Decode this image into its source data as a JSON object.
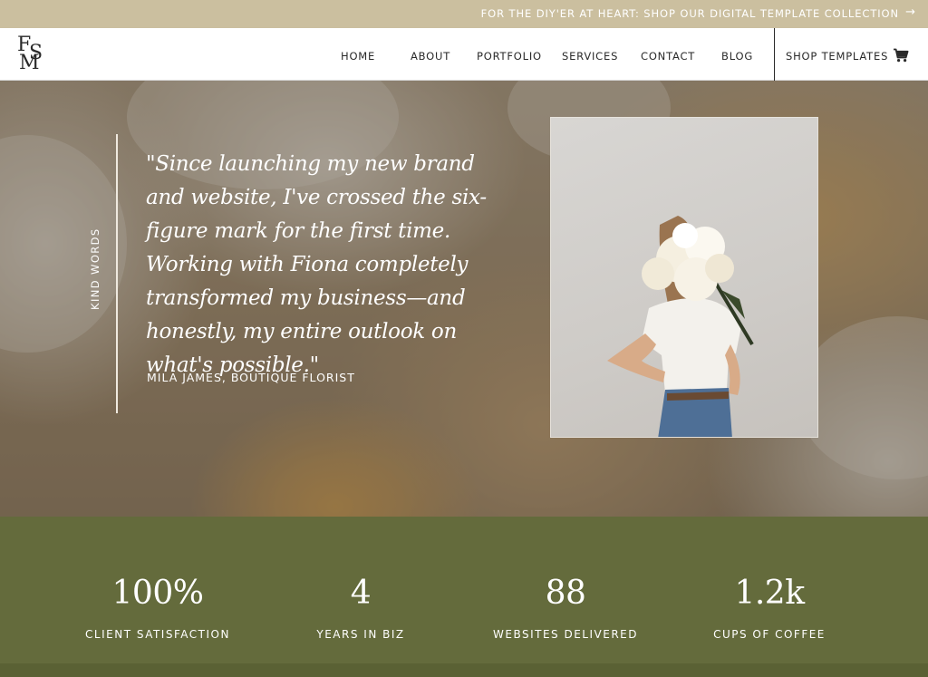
{
  "announcement": {
    "text": "FOR THE DIY'ER AT HEART: SHOP OUR DIGITAL TEMPLATE COLLECTION",
    "arrow": "→"
  },
  "logo": {
    "letters": [
      "F",
      "S",
      "M"
    ]
  },
  "nav": {
    "items": [
      "HOME",
      "ABOUT",
      "PORTFOLIO",
      "SERVICES",
      "CONTACT",
      "BLOG"
    ],
    "shop": "SHOP TEMPLATES",
    "cart_icon": "cart-icon"
  },
  "testimonial": {
    "section_label": "KIND WORDS",
    "quote": "\"Since launching my new brand and website, I've crossed the six-figure mark for the first time. Working with Fiona completely transformed my business—and honestly, my entire outlook on what's possible.\"",
    "author": "MILA JAMES, BOUTIQUE FLORIST"
  },
  "stats": [
    {
      "value": "100%",
      "label": "CLIENT SATISFACTION"
    },
    {
      "value": "4",
      "label": "YEARS IN BIZ"
    },
    {
      "value": "88",
      "label": "WEBSITES DELIVERED"
    },
    {
      "value": "1.2k",
      "label": "CUPS OF COFFEE"
    }
  ],
  "colors": {
    "announcement_bg": "#cbbf9f",
    "stats_bg": "#646b3c",
    "text_dark": "#2a2a2a"
  }
}
